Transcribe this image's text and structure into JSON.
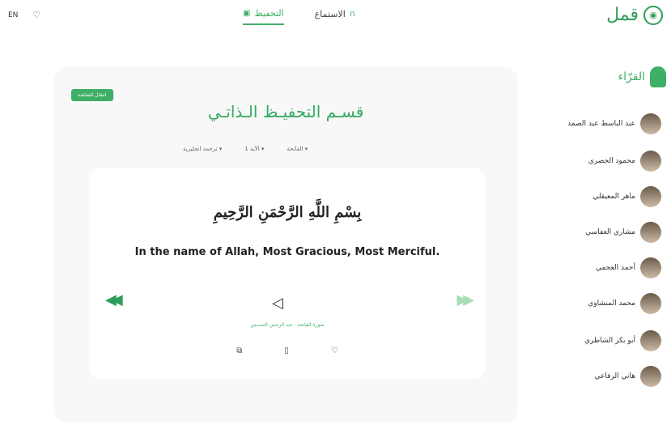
{
  "top": {
    "lang": "EN",
    "heart_icon": "heart-icon"
  },
  "tabs": [
    {
      "label": "التحفيظ",
      "active": true
    },
    {
      "label": "الاستماع",
      "active": false
    }
  ],
  "logo": "قمل",
  "main": {
    "pill": "انتقال للشاشة",
    "title": "قسـم التحفيـظ الـذاتـي",
    "filters": [
      "ترجمة انجليزية",
      "الآية 1",
      "الفاتحة"
    ],
    "arabic_verse": "بِسْمِ اللَّهِ الرَّحْمَنِ الرَّحِيمِ",
    "english": "In the name of Allah, Most Gracious, Most Merciful.",
    "surah_info": "سورة الفاتحة · عبد الرحمن السديس"
  },
  "sidebar": {
    "title": "القرّاء",
    "reciters": [
      "عبد الباسط عبد الصمد",
      "محمود الحصري",
      "ماهر المعيقلي",
      "مشاري العفاسي",
      "أحمد العجمي",
      "محمد المنشاوي",
      "أبو بكر الشاطري",
      "هاني الرفاعي"
    ]
  }
}
